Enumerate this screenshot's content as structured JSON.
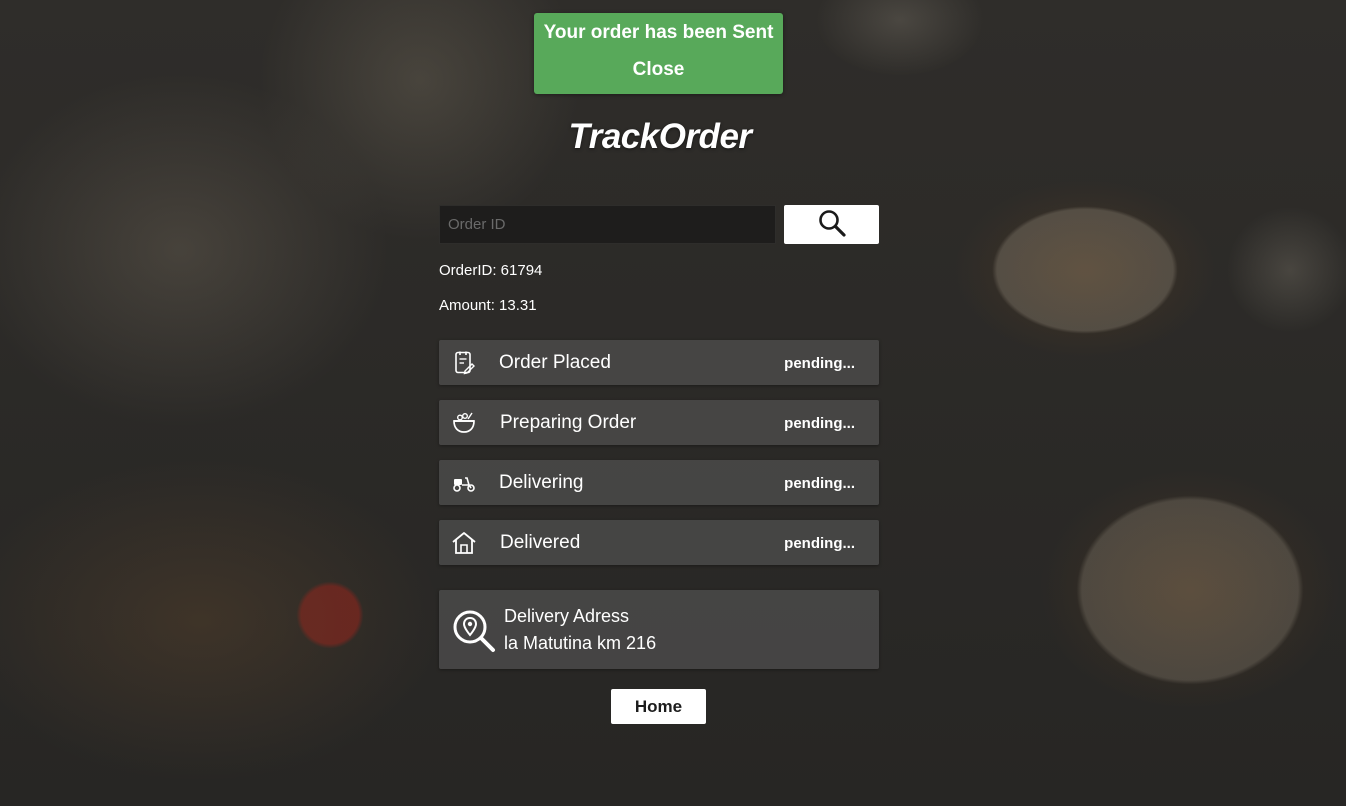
{
  "toast": {
    "message": "Your order has been Sent",
    "close_label": "Close",
    "color": "#58a95a"
  },
  "header": {
    "title": "TrackOrder"
  },
  "search": {
    "placeholder": "Order ID",
    "value": "",
    "button_icon": "search-icon"
  },
  "order": {
    "id_text": "OrderID: 61794",
    "amount_text": "Amount: 13.31"
  },
  "steps": [
    {
      "label": "Order Placed",
      "status": "pending...",
      "icon": "order-placed-icon"
    },
    {
      "label": "Preparing Order",
      "status": "pending...",
      "icon": "food-bowl-icon"
    },
    {
      "label": "Delivering",
      "status": "pending...",
      "icon": "scooter-icon"
    },
    {
      "label": "Delivered",
      "status": "pending...",
      "icon": "house-icon"
    }
  ],
  "delivery": {
    "title": "Delivery Adress",
    "address": "la Matutina km 216",
    "icon": "location-search-icon"
  },
  "footer": {
    "home_label": "Home"
  }
}
